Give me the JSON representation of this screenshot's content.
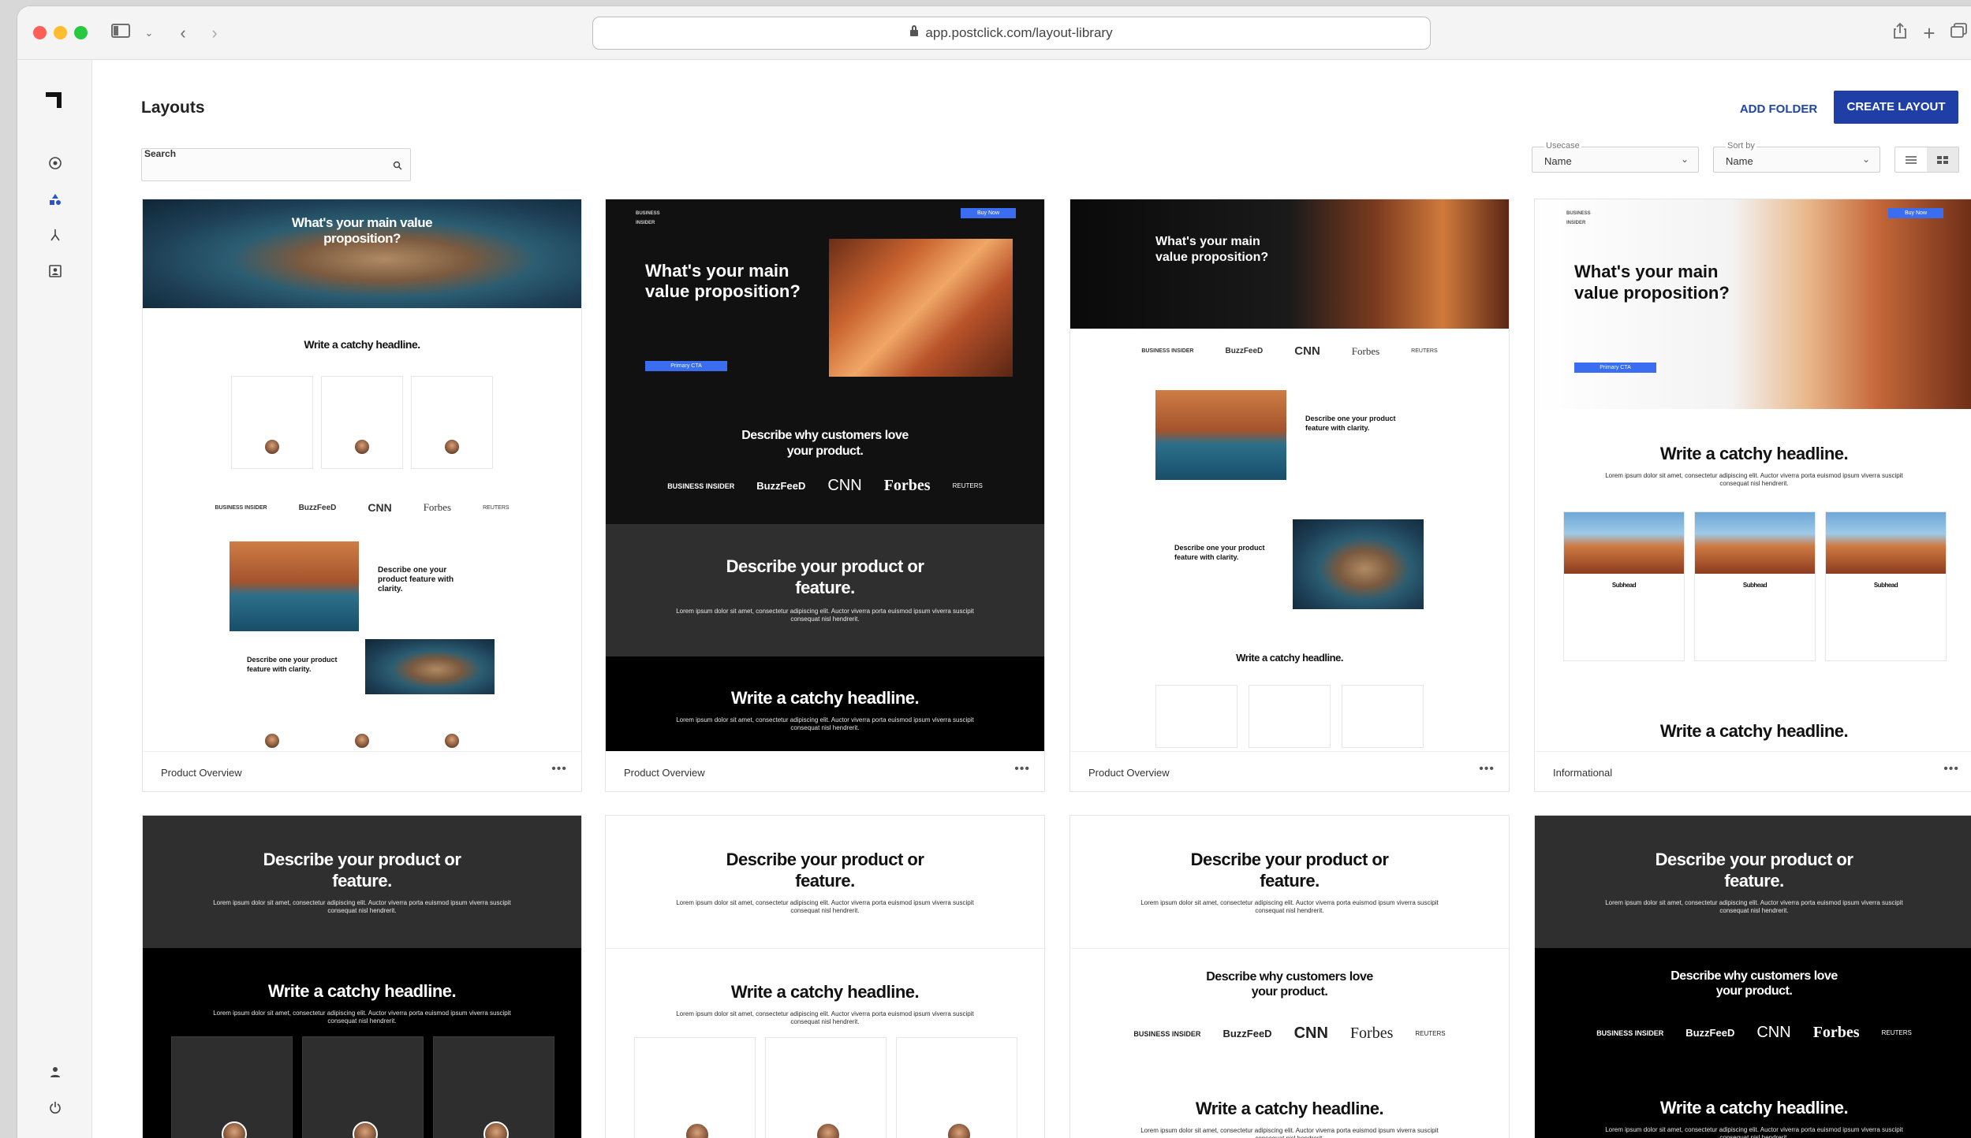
{
  "browser": {
    "url": "app.postclick.com/layout-library"
  },
  "page": {
    "title": "Layouts",
    "add_folder": "ADD FOLDER",
    "create_layout": "CREATE LAYOUT"
  },
  "search": {
    "label": "Search",
    "placeholder": ""
  },
  "filters": {
    "usecase_label": "Usecase",
    "usecase_value": "Name",
    "sortby_label": "Sort by",
    "sortby_value": "Name"
  },
  "preview_text": {
    "value_prop": "What's your main value proposition?",
    "catchy": "Write a catchy headline.",
    "describe_product": "Describe your product or feature.",
    "describe_customers": "Describe why customers love your product.",
    "describe_one": "Describe one your product feature with clarity.",
    "lorem": "Lorem ipsum dolor sit amet, consectetur adipiscing elit. Auctor viverra porta euismod ipsum viverra suscipit consequat nisl hendrerit.",
    "primary_cta": "Primary CTA",
    "buy_now": "Buy Now",
    "subhead": "Subhead",
    "brand_bi": "BUSINESS INSIDER",
    "brand_buzzfeed": "BuzzFeeD",
    "brand_cnn": "CNN",
    "brand_forbes": "Forbes",
    "brand_reuters": "REUTERS"
  },
  "cards": [
    {
      "name": "Product Overview",
      "more": "•••"
    },
    {
      "name": "Product Overview",
      "more": "•••"
    },
    {
      "name": "Product Overview",
      "more": "•••"
    },
    {
      "name": "Informational",
      "more": "•••"
    }
  ],
  "colors": {
    "brand_blue": "#1f3fa6",
    "cta_blue": "#3b6df0",
    "cta_red": "#e94545"
  }
}
